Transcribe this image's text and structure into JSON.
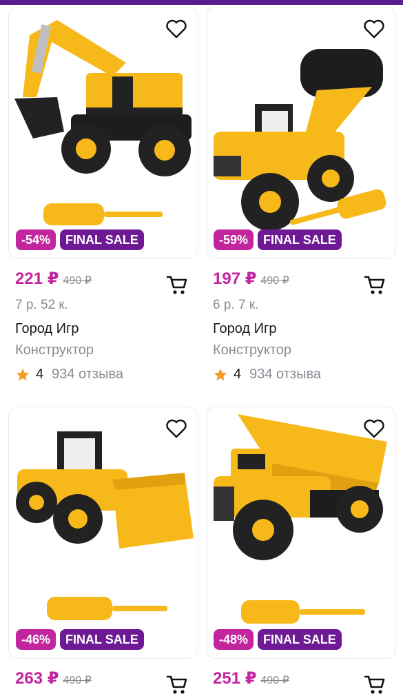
{
  "colors": {
    "accent": "#c3259f",
    "final_sale": "#6e1a95",
    "top_bar": "#5a1e8c",
    "star": "#f59a23"
  },
  "products": [
    {
      "image": "toy-excavator",
      "discount": "-54%",
      "sale_label": "FINAL SALE",
      "price": "221 ₽",
      "old_price": "490 ₽",
      "per_unit": "7 р. 52 к.",
      "brand": "Город Игр",
      "category": "Конструктор",
      "rating": "4",
      "reviews": "934 отзыва"
    },
    {
      "image": "toy-road-roller",
      "discount": "-59%",
      "sale_label": "FINAL SALE",
      "price": "197 ₽",
      "old_price": "490 ₽",
      "per_unit": "6 р. 7 к.",
      "brand": "Город Игр",
      "category": "Конструктор",
      "rating": "4",
      "reviews": "934 отзыва"
    },
    {
      "image": "toy-bulldozer-loader",
      "discount": "-46%",
      "sale_label": "FINAL SALE",
      "price": "263 ₽",
      "old_price": "490 ₽"
    },
    {
      "image": "toy-dump-truck",
      "discount": "-48%",
      "sale_label": "FINAL SALE",
      "price": "251 ₽",
      "old_price": "490 ₽"
    }
  ]
}
